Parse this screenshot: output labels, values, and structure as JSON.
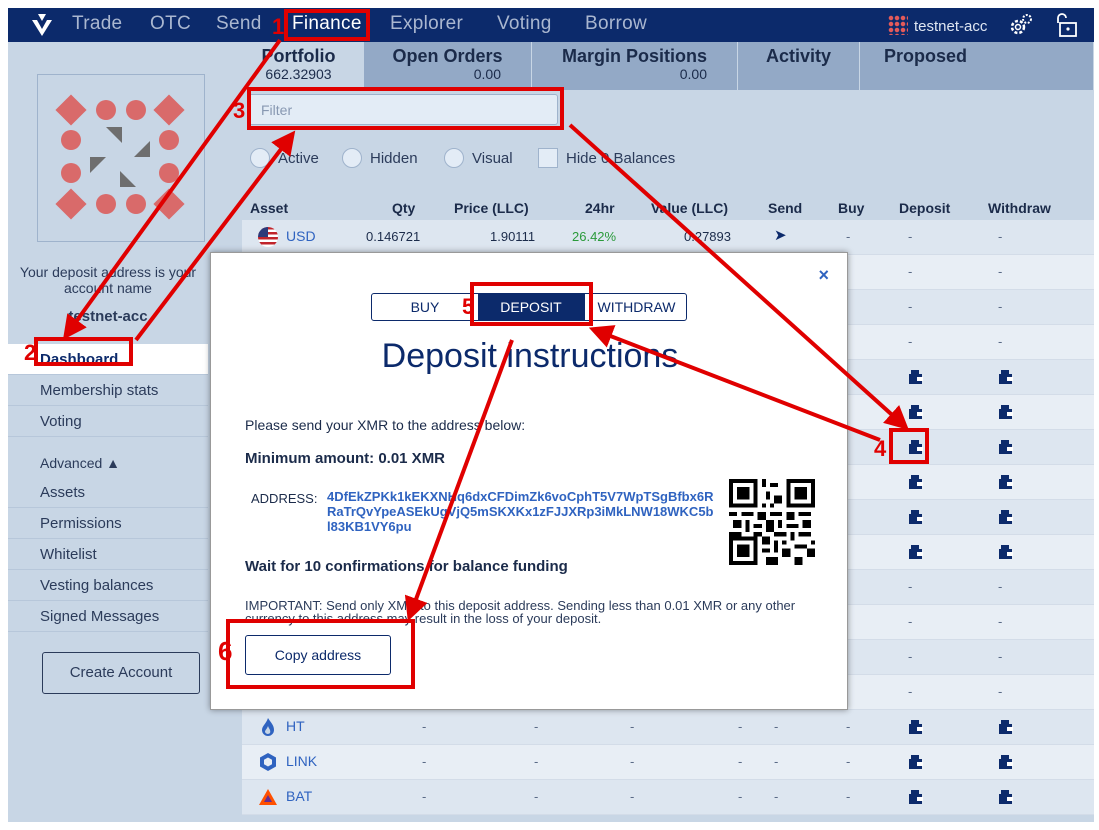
{
  "topbar": {
    "nav": [
      "Trade",
      "OTC",
      "Send",
      "Finance",
      "Explorer",
      "Voting",
      "Borrow"
    ],
    "active_nav": "Finance",
    "account": "testnet-acc"
  },
  "tabs": [
    {
      "label": "Portfolio",
      "value": "662.32903"
    },
    {
      "label": "Open Orders",
      "value": "0.00"
    },
    {
      "label": "Margin Positions",
      "value": "0.00"
    },
    {
      "label": "Activity",
      "value": ""
    },
    {
      "label": "Proposed",
      "value": ""
    }
  ],
  "sidebar": {
    "deposit_text": "Your deposit address is your account name",
    "account": "testnet-acc",
    "items": [
      "Dashboard",
      "Membership stats",
      "Voting"
    ],
    "advanced": "Advanced ▲",
    "advanced_items": [
      "Assets",
      "Permissions",
      "Whitelist",
      "Vesting balances",
      "Signed Messages"
    ],
    "create_account": "Create Account"
  },
  "filter": {
    "placeholder": "Filter"
  },
  "radios": {
    "active": "Active",
    "hidden": "Hidden",
    "visual": "Visual",
    "hide_zero": "Hide 0 Balances"
  },
  "table": {
    "headers": [
      "Asset",
      "Qty",
      "Price (LLC)",
      "24hr",
      "Value (LLC)",
      "Send",
      "Buy",
      "Deposit",
      "Withdraw"
    ],
    "usd_row": {
      "asset": "USD",
      "qty": "0.146721",
      "price": "1.90111",
      "change": "26.42%",
      "value": "0.27893",
      "send": "➤",
      "buy": "-",
      "deposit": "-",
      "withdraw": "-"
    },
    "dash": "-",
    "bottom_rows": [
      {
        "asset": "HT"
      },
      {
        "asset": "LINK"
      },
      {
        "asset": "BAT"
      }
    ]
  },
  "modal": {
    "close": "×",
    "buy": "BUY",
    "deposit": "DEPOSIT",
    "withdraw": "WITHDRAW",
    "title": "Deposit instructions",
    "send_text": "Please send your XMR to the address below:",
    "minimum": "Minimum amount: 0.01 XMR",
    "address_label": "ADDRESS:",
    "address": "4DfEkZPKk1kEKXNHq6dxCFDimZk6voCphT5V7WpTSgBfbx6RRaTrQvYpeASEkUgVjQ5mSKXKx1zFJJXRp3iMkLNW18WKC5bl83KB1VY6pu",
    "wait": "Wait for 10 confirmations for balance funding",
    "important": "IMPORTANT: Send only XMR to this deposit address. Sending less than 0.01 XMR or any other currency to this address may result in the loss of your deposit.",
    "copy": "Copy address"
  },
  "annotations": [
    "1",
    "2",
    "3",
    "4",
    "5",
    "6"
  ],
  "colors": {
    "accent": "#0c2a6b",
    "annotation": "#e00000",
    "positive": "#2a9a3a",
    "link": "#2f63c0"
  }
}
